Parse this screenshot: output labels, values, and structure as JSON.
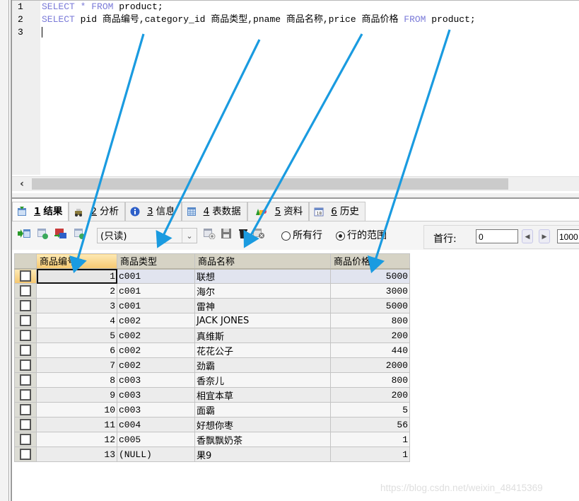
{
  "editor": {
    "line_numbers": [
      "1",
      "2",
      "3"
    ],
    "lines": [
      [
        {
          "t": "SELECT",
          "kw": true
        },
        {
          "t": " "
        },
        {
          "t": "*",
          "kw": true
        },
        {
          "t": " "
        },
        {
          "t": "FROM",
          "kw": true
        },
        {
          "t": " product;"
        }
      ],
      [
        {
          "t": "SELECT",
          "kw": true
        },
        {
          "t": " pid 商品编号,category_id 商品类型,pname 商品名称,price 商品价格 "
        },
        {
          "t": "FROM",
          "kw": true
        },
        {
          "t": " product;"
        }
      ],
      []
    ],
    "scroll_left_icon": "chevron-left-icon"
  },
  "tabs": [
    {
      "num": "1",
      "label": "结果",
      "icon": "result-grid-icon",
      "active": true
    },
    {
      "num": "2",
      "label": "分析",
      "icon": "profiler-icon",
      "active": false
    },
    {
      "num": "3",
      "label": "信息",
      "icon": "info-icon",
      "active": false
    },
    {
      "num": "4",
      "label": "表数据",
      "icon": "table-data-icon",
      "active": false
    },
    {
      "num": "5",
      "label": "资料",
      "icon": "shapes-icon",
      "active": false
    },
    {
      "num": "6",
      "label": "历史",
      "icon": "calendar-icon",
      "active": false
    }
  ],
  "toolbar": {
    "mode_select": "(只读)",
    "radio_all_rows": "所有行",
    "radio_row_range": "行的范围",
    "radio_selected": "row_range",
    "first_row_label": "首行:",
    "first_row_value": "0",
    "row_count_value": "1000"
  },
  "grid": {
    "columns": [
      "商品编号",
      "商品类型",
      "商品名称",
      "商品价格"
    ],
    "rows": [
      [
        "1",
        "c001",
        "联想",
        "5000"
      ],
      [
        "2",
        "c001",
        "海尔",
        "3000"
      ],
      [
        "3",
        "c001",
        "雷神",
        "5000"
      ],
      [
        "4",
        "c002",
        "JACK JONES",
        "800"
      ],
      [
        "5",
        "c002",
        "真维斯",
        "200"
      ],
      [
        "6",
        "c002",
        "花花公子",
        "440"
      ],
      [
        "7",
        "c002",
        "劲霸",
        "2000"
      ],
      [
        "8",
        "c003",
        "香奈儿",
        "800"
      ],
      [
        "9",
        "c003",
        "相宜本草",
        "200"
      ],
      [
        "10",
        "c003",
        "面霸",
        "5"
      ],
      [
        "11",
        "c004",
        "好想你枣",
        "56"
      ],
      [
        "12",
        "c005",
        "香飘飘奶茶",
        "1"
      ],
      [
        "13",
        "(NULL)",
        "果9",
        "1"
      ]
    ]
  },
  "annotation_color": "#1a9be0",
  "watermark": "https://blog.csdn.net/weixin_48415369"
}
